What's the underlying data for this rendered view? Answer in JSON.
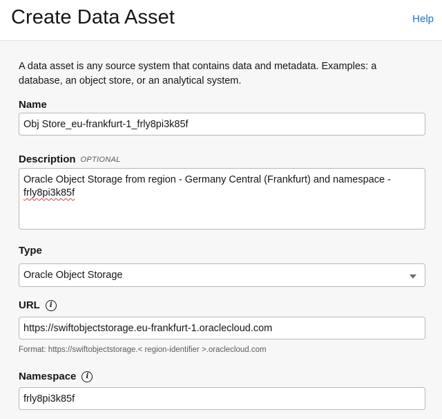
{
  "header": {
    "title": "Create Data Asset",
    "help_label": "Help"
  },
  "intro_text": "A data asset is any source system that contains data and metadata. Examples: a database, an object store, or an analytical system.",
  "form": {
    "name": {
      "label": "Name",
      "value": "Obj Store_eu-frankfurt-1_frly8pi3k85f"
    },
    "description": {
      "label": "Description",
      "optional_label": "OPTIONAL",
      "value_line1": "Oracle Object Storage from region - Germany Central (Frankfurt) and namespace -",
      "value_line2": "frly8pi3k85f"
    },
    "type": {
      "label": "Type",
      "selected": "Oracle Object Storage",
      "icon": "chevron-down-icon"
    },
    "url": {
      "label": "URL",
      "info_icon": "info-icon",
      "value": "https://swiftobjectstorage.eu-frankfurt-1.oraclecloud.com",
      "hint": "Format: https://swiftobjectstorage.< region-identifier >.oraclecloud.com"
    },
    "namespace": {
      "label": "Namespace",
      "info_icon": "info-icon",
      "value": "frly8pi3k85f"
    }
  },
  "colors": {
    "link": "#1a73c6",
    "background": "#f7f7f7",
    "field_border": "#bcb6b1",
    "spellcheck": "#d23b3b"
  }
}
